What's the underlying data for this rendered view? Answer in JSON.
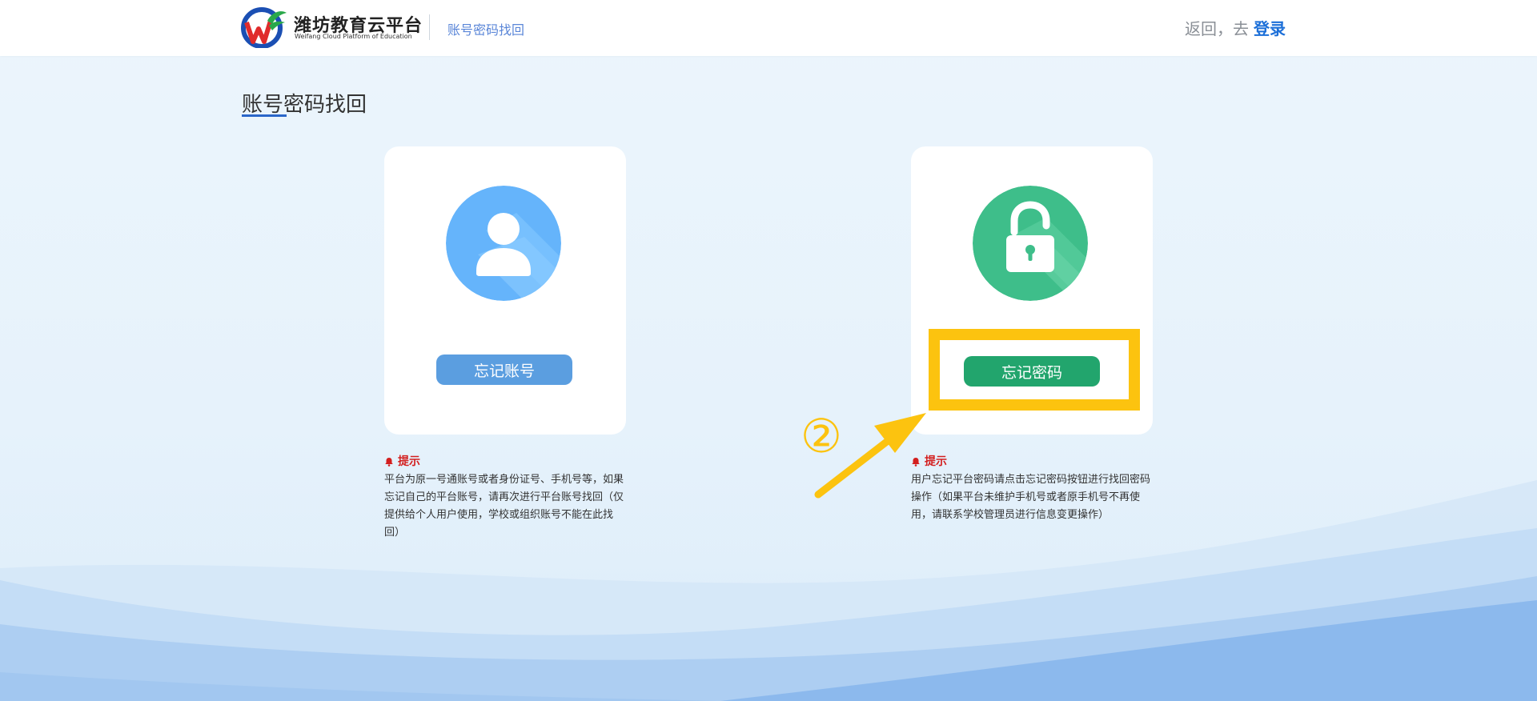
{
  "header": {
    "brand_title": "潍坊教育云平台",
    "brand_subtitle": "Weifang Cloud Platform of Education",
    "page_subtitle": "账号密码找回",
    "back_text": "返回，去",
    "login_label": "登录"
  },
  "main": {
    "page_title": "账号密码找回",
    "cards": [
      {
        "button_label": "忘记账号",
        "icon": "user-icon",
        "hint_title": "提示",
        "hint_text": "平台为原一号通账号或者身份证号、手机号等，如果忘记自己的平台账号，请再次进行平台账号找回（仅提供给个人用户使用，学校或组织账号不能在此找回）"
      },
      {
        "button_label": "忘记密码",
        "icon": "unlock-icon",
        "hint_title": "提示",
        "hint_text": "用户忘记平台密码请点击忘记密码按钮进行找回密码操作（如果平台未维护手机号或者原手机号不再使用，请联系学校管理员进行信息变更操作）"
      }
    ]
  },
  "annotation": {
    "step_marker": "②",
    "highlight_color": "#fcc30f"
  },
  "colors": {
    "accent_blue": "#1c6fd8",
    "account_button": "#5b9ee0",
    "password_button": "#22a56d",
    "hint_red": "#d31f1f"
  }
}
